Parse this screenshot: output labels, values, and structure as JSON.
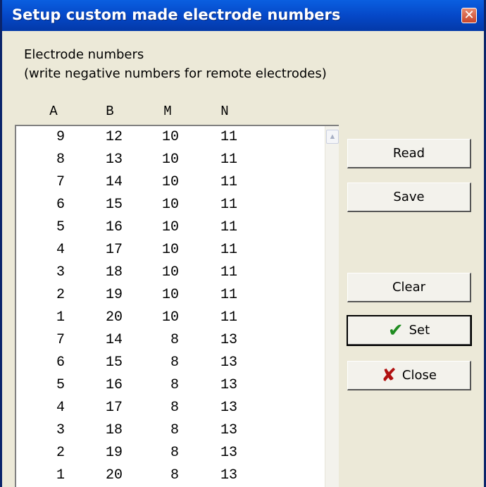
{
  "window": {
    "title": "Setup custom made electrode numbers",
    "close_glyph": "✕"
  },
  "labels": {
    "line1": "Electrode numbers",
    "line2": "(write negative numbers for remote electrodes)"
  },
  "columns": [
    "A",
    "B",
    "M",
    "N"
  ],
  "rows": [
    [
      "9",
      "12",
      "10",
      "11"
    ],
    [
      "8",
      "13",
      "10",
      "11"
    ],
    [
      "7",
      "14",
      "10",
      "11"
    ],
    [
      "6",
      "15",
      "10",
      "11"
    ],
    [
      "5",
      "16",
      "10",
      "11"
    ],
    [
      "4",
      "17",
      "10",
      "11"
    ],
    [
      "3",
      "18",
      "10",
      "11"
    ],
    [
      "2",
      "19",
      "10",
      "11"
    ],
    [
      "1",
      "20",
      "10",
      "11"
    ],
    [
      "7",
      "14",
      "8",
      "13"
    ],
    [
      "6",
      "15",
      "8",
      "13"
    ],
    [
      "5",
      "16",
      "8",
      "13"
    ],
    [
      "4",
      "17",
      "8",
      "13"
    ],
    [
      "3",
      "18",
      "8",
      "13"
    ],
    [
      "2",
      "19",
      "8",
      "13"
    ],
    [
      "1",
      "20",
      "8",
      "13"
    ]
  ],
  "buttons": {
    "read": "Read",
    "save": "Save",
    "clear": "Clear",
    "set": "Set",
    "close": "Close"
  },
  "icons": {
    "set": "checkmark-icon",
    "close": "x-icon",
    "ok_color": "#1f8c1f",
    "x_color": "#b01010"
  }
}
